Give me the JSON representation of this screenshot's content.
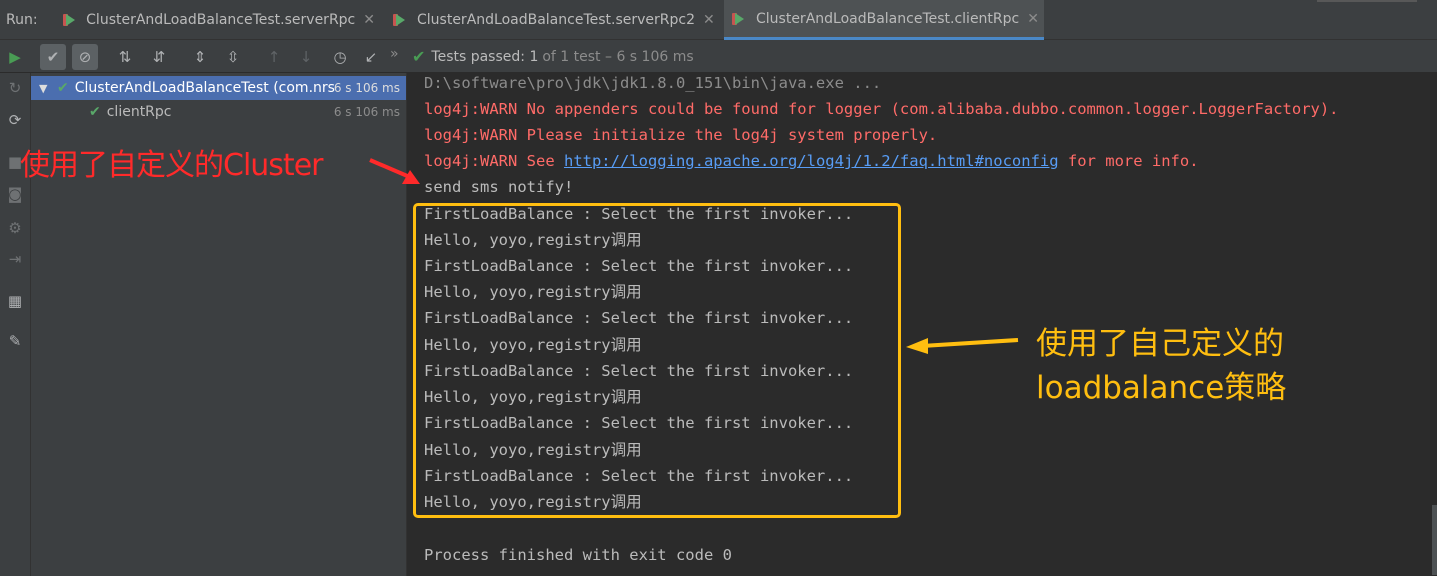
{
  "run_bar": {
    "label": "Run:",
    "tabs": [
      {
        "label": "ClusterAndLoadBalanceTest.serverRpc",
        "close": "✕",
        "active": false
      },
      {
        "label": "ClusterAndLoadBalanceTest.serverRpc2",
        "close": "✕",
        "active": false
      },
      {
        "label": "ClusterAndLoadBalanceTest.clientRpc",
        "close": "✕",
        "active": true
      }
    ]
  },
  "toolbar": {
    "more": "»",
    "status_main": "Tests passed: 1",
    "status_rest": "of 1 test – 6 s 106 ms"
  },
  "tree": {
    "root": {
      "label": "ClusterAndLoadBalanceTest (com.nrs",
      "time": "6 s 106 ms"
    },
    "child": {
      "label": "clientRpc",
      "time": "6 s 106 ms"
    }
  },
  "console": {
    "cmd": "D:\\software\\pro\\jdk\\jdk1.8.0_151\\bin\\java.exe ...",
    "warn1": "log4j:WARN No appenders could be found for logger (com.alibaba.dubbo.common.logger.LoggerFactory).",
    "warn2": "log4j:WARN Please initialize the log4j system properly.",
    "warn3_prefix": "log4j:WARN See ",
    "warn3_link": "http://logging.apache.org/log4j/1.2/faq.html#noconfig",
    "warn3_suffix": " for more info.",
    "notify": "send sms notify!",
    "lines": [
      "FirstLoadBalance : Select the first invoker...",
      "Hello, yoyo,registry调用",
      "FirstLoadBalance : Select the first invoker...",
      "Hello, yoyo,registry调用",
      "FirstLoadBalance : Select the first invoker...",
      "Hello, yoyo,registry调用",
      "FirstLoadBalance : Select the first invoker...",
      "Hello, yoyo,registry调用",
      "FirstLoadBalance : Select the first invoker...",
      "Hello, yoyo,registry调用",
      "FirstLoadBalance : Select the first invoker...",
      "Hello, yoyo,registry调用"
    ],
    "finish": "Process finished with exit code 0"
  },
  "annotations": {
    "cluster_note": "使用了自定义的Cluster",
    "loadbalance_note_line1": "使用了自己定义的",
    "loadbalance_note_line2": "loadbalance策略",
    "red_color": "#ff2a2a",
    "orange_color": "#ffbe10"
  },
  "icons": {
    "toolbar": [
      "run-icon",
      "show-passed-icon",
      "show-ignored-icon",
      "sort-alpha-icon",
      "sort-duration-icon",
      "expand-all-icon",
      "collapse-all-icon",
      "prev-failed-icon",
      "next-failed-icon",
      "history-icon",
      "export-icon"
    ],
    "left_strip": [
      "rerun-icon",
      "rerun-failed-icon",
      "toggle-auto-test-icon",
      "stop-icon",
      "camera-icon",
      "settings-icon",
      "exit-icon",
      "layout-icon",
      "pin-icon"
    ]
  }
}
